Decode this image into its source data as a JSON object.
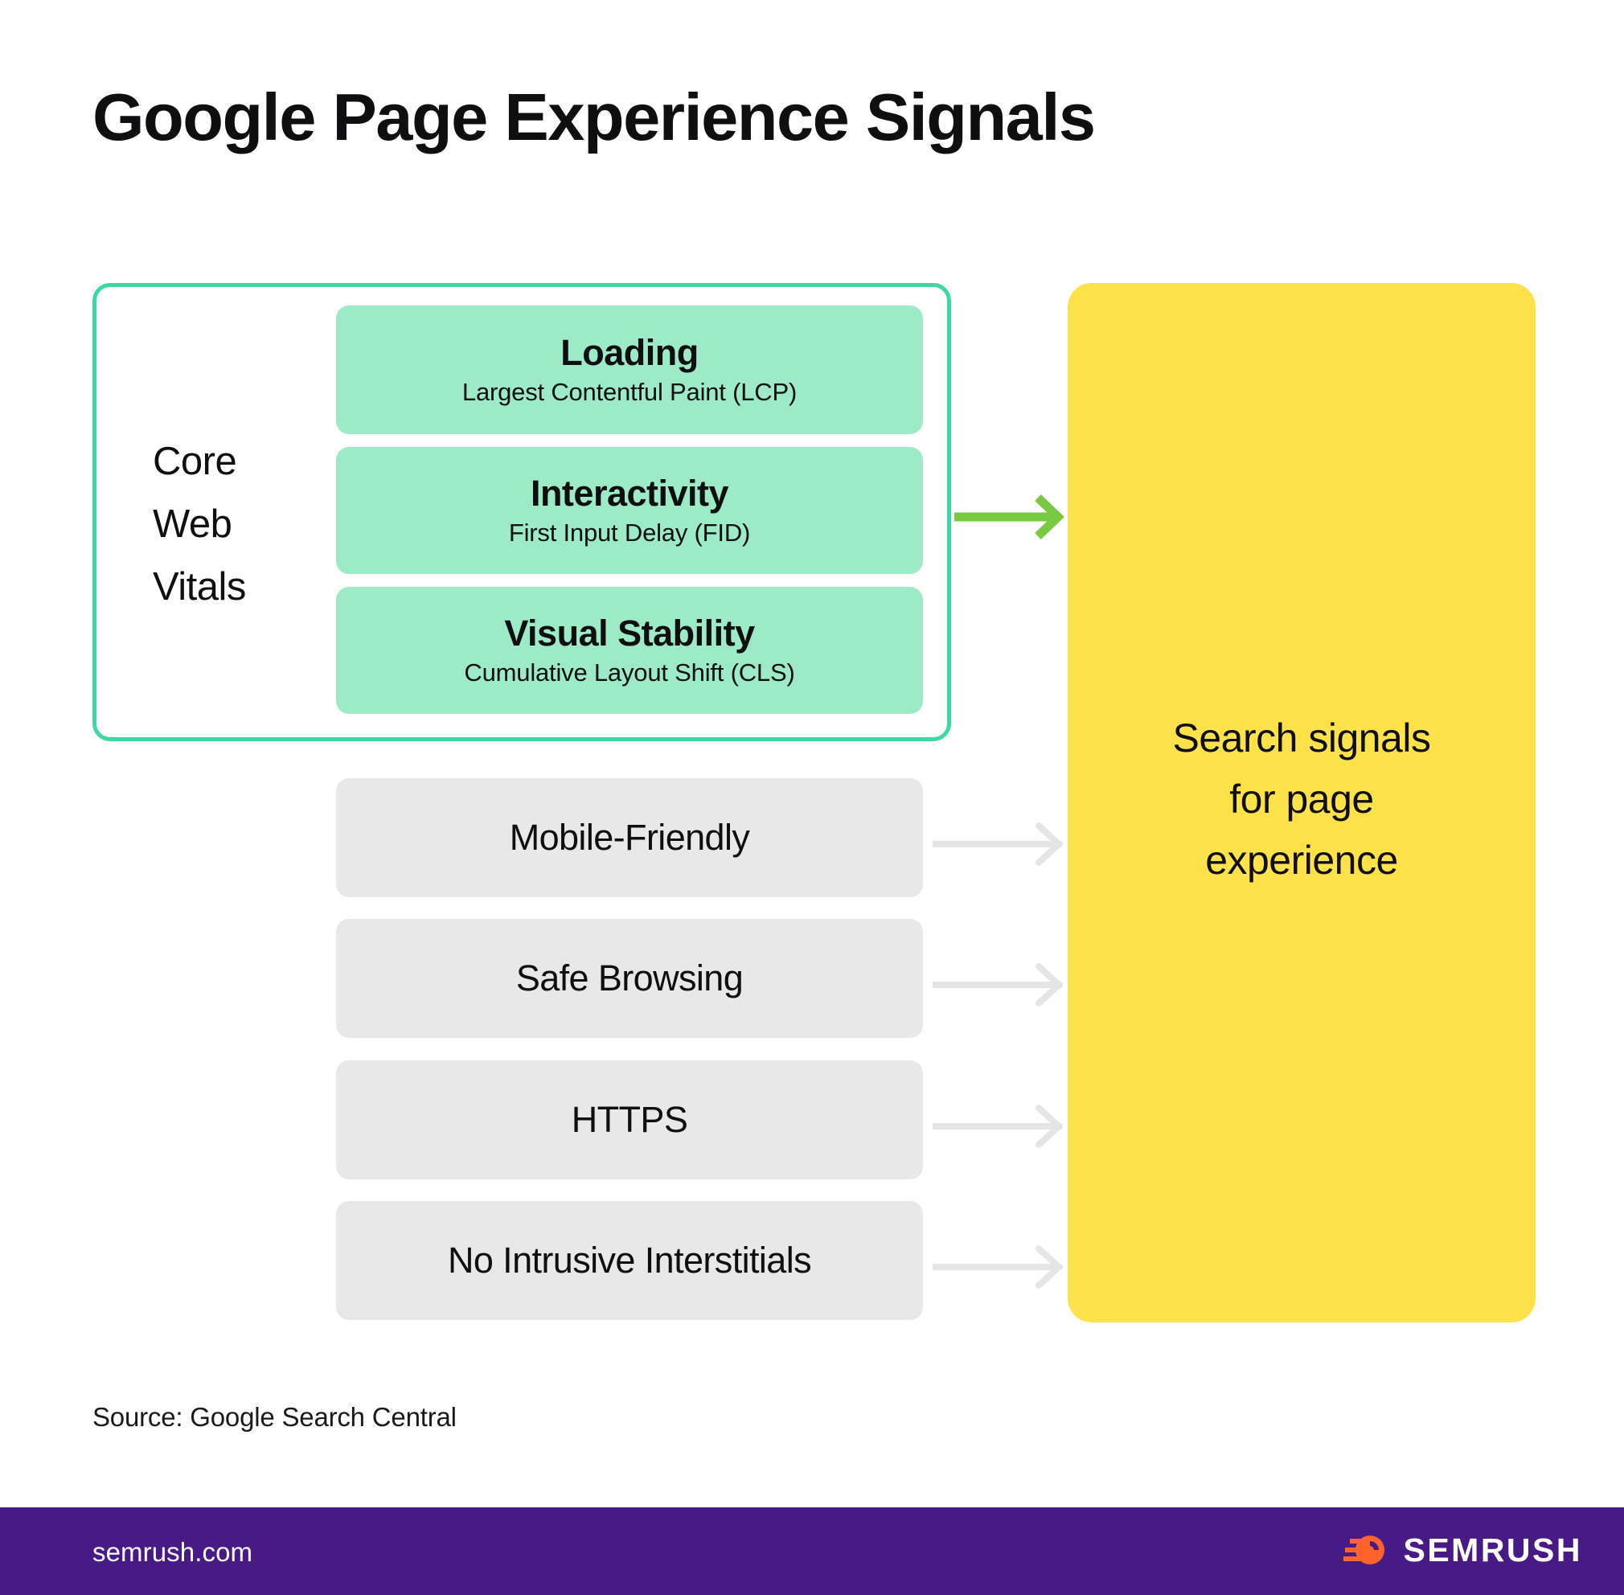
{
  "page": {
    "title": "Google Page Experience Signals",
    "source_note": "Source: Google Search Central",
    "background_color": "#ffffff"
  },
  "core_web_vitals": {
    "group_label": "Core\nWeb\nVitals",
    "group_label_line1": "Core",
    "group_label_line2": "Web",
    "group_label_line3": "Vitals",
    "border_color": "#3ed9a0",
    "card_color": "#9debc6",
    "metrics": [
      {
        "title": "Loading",
        "subtitle": "Largest Contentful Paint (LCP)"
      },
      {
        "title": "Interactivity",
        "subtitle": "First Input Delay (FID)"
      },
      {
        "title": "Visual Stability",
        "subtitle": "Cumulative Layout Shift (CLS)"
      }
    ]
  },
  "other_signals": {
    "card_color": "#e8e8e8",
    "items": [
      {
        "label": "Mobile-Friendly"
      },
      {
        "label": "Safe Browsing"
      },
      {
        "label": "HTTPS"
      },
      {
        "label": "No Intrusive Interstitials"
      }
    ]
  },
  "arrows": {
    "primary_color": "#7ac943",
    "secondary_color": "#e8e8e8",
    "primary_name": "core-web-vitals-arrow",
    "secondary_name": "signal-arrow"
  },
  "destination": {
    "line1": "Search signals",
    "line2": "for page",
    "line3": "experience",
    "background_color": "#ffe249"
  },
  "footer": {
    "url": "semrush.com",
    "brand": "SEMRUSH",
    "background_color": "#471a85",
    "logo_color": "#ff642d"
  }
}
